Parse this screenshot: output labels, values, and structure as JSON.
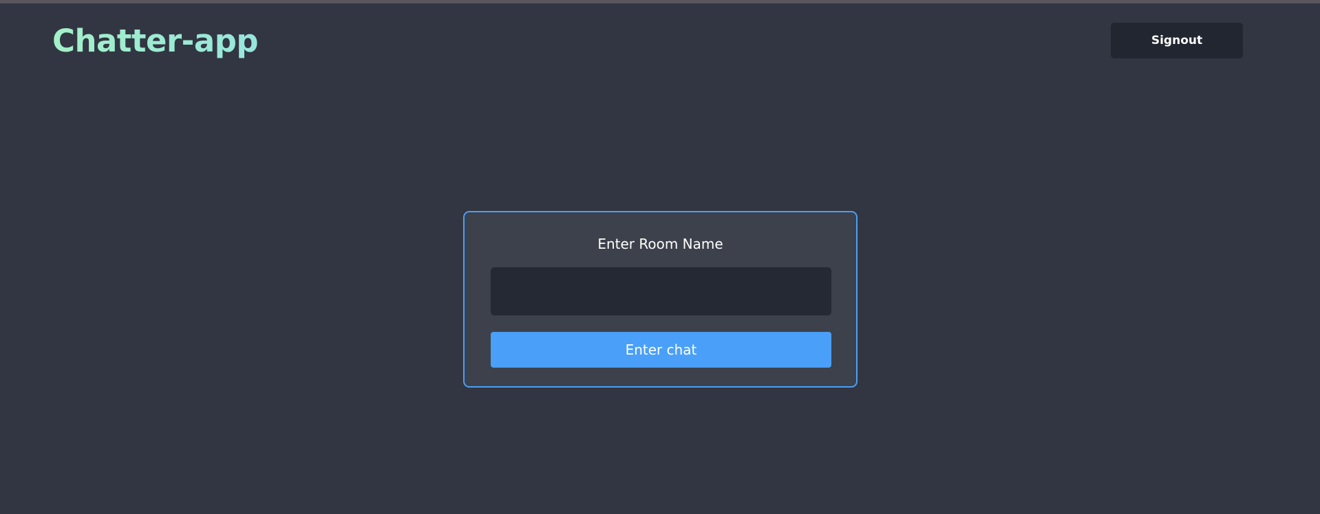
{
  "app": {
    "title": "Chatter-app"
  },
  "header": {
    "signout_label": "Signout"
  },
  "room_form": {
    "title": "Enter Room Name",
    "input_value": "",
    "input_placeholder": "",
    "submit_label": "Enter chat"
  },
  "colors": {
    "background": "#323642",
    "card_background": "#3d414b",
    "card_border": "#4aa0f5",
    "primary_button": "#4a9ff8",
    "logo_accent": "#a4f0c8"
  }
}
